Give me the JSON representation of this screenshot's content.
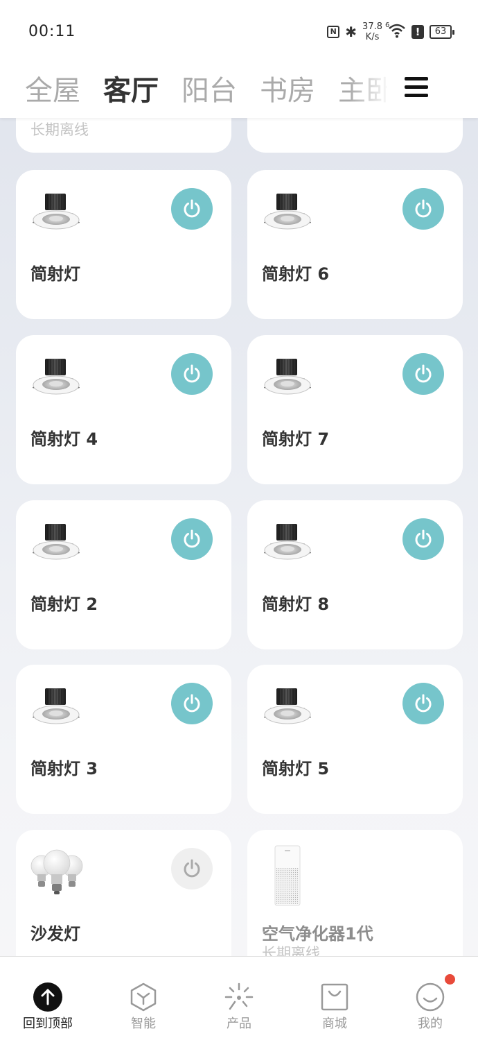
{
  "status": {
    "time": "00:11",
    "nfc": "N",
    "bluetooth": "✱",
    "speed_value": "37.8",
    "speed_unit": "K/s",
    "wifi_superscript": "6",
    "alert": "!",
    "battery": "63"
  },
  "tabs": [
    {
      "label": "全屋",
      "active": false
    },
    {
      "label": "客厅",
      "active": true
    },
    {
      "label": "阳台",
      "active": false
    },
    {
      "label": "书房",
      "active": false
    },
    {
      "label": "主卧",
      "active": false
    }
  ],
  "top_partial": {
    "left_status": "长期离线"
  },
  "devices": [
    {
      "name": "简射灯",
      "icon": "downlight-icon",
      "power": "on"
    },
    {
      "name": "简射灯 6",
      "icon": "downlight-icon",
      "power": "on"
    },
    {
      "name": "简射灯 4",
      "icon": "downlight-icon",
      "power": "on"
    },
    {
      "name": "简射灯 7",
      "icon": "downlight-icon",
      "power": "on"
    },
    {
      "name": "简射灯 2",
      "icon": "downlight-icon",
      "power": "on"
    },
    {
      "name": "简射灯 8",
      "icon": "downlight-icon",
      "power": "on"
    },
    {
      "name": "简射灯 3",
      "icon": "downlight-icon",
      "power": "on"
    },
    {
      "name": "简射灯 5",
      "icon": "downlight-icon",
      "power": "on"
    },
    {
      "name": "沙发灯",
      "icon": "bulbs-icon",
      "power": "off"
    },
    {
      "name": "空气净化器1代",
      "icon": "air-purifier-icon",
      "status": "长期离线"
    }
  ],
  "bottom_nav": [
    {
      "label": "回到顶部",
      "icon": "arrow-up-icon",
      "active": true
    },
    {
      "label": "智能",
      "icon": "smart-cube-icon",
      "active": false
    },
    {
      "label": "产品",
      "icon": "product-spark-icon",
      "active": false
    },
    {
      "label": "商城",
      "icon": "shop-bag-icon",
      "active": false
    },
    {
      "label": "我的",
      "icon": "profile-smile-icon",
      "active": false,
      "badge": true
    }
  ],
  "colors": {
    "power_on": "#76c5cb",
    "power_off": "#efefef",
    "badge": "#e84a3a"
  }
}
